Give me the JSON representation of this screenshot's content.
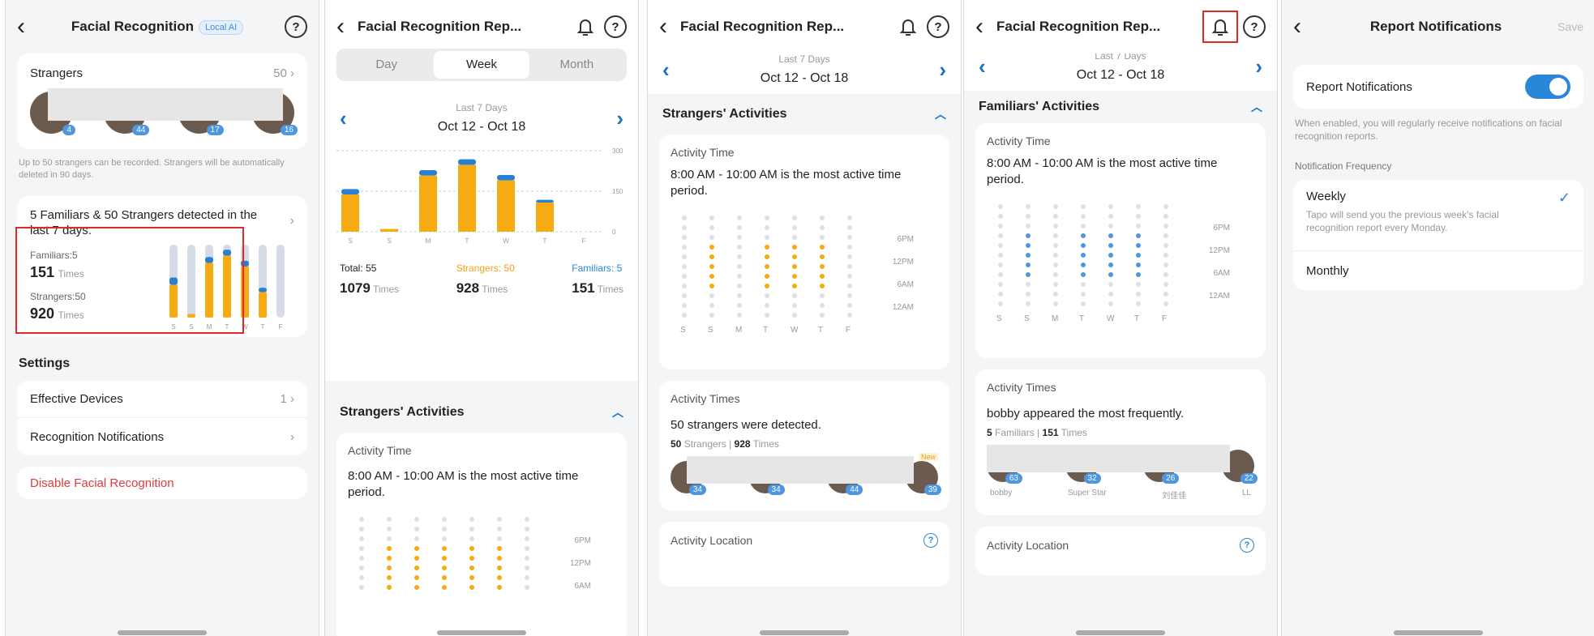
{
  "p1": {
    "title": "Facial Recognition",
    "badge": "Local AI",
    "strangers_label": "Strangers",
    "strangers_count": "50",
    "faces": [
      "4",
      "44",
      "17",
      "16"
    ],
    "note": "Up to 50 strangers can be recorded. Strangers will be automatically deleted in 90 days.",
    "summary": "5 Familiars & 50 Strangers detected in the last 7 days.",
    "familiars_label": "Familiars:5",
    "familiars_times": "151",
    "times_word": "Times",
    "strangers2_label": "Strangers:50",
    "strangers2_times": "920",
    "days": [
      "S",
      "S",
      "M",
      "T",
      "W",
      "T",
      "F"
    ],
    "bars": {
      "strangers": [
        0.45,
        0.05,
        0.75,
        0.85,
        0.7,
        0.35,
        0
      ],
      "familiars": [
        0.1,
        0,
        0.08,
        0.08,
        0.08,
        0.06,
        0
      ]
    },
    "settings_title": "Settings",
    "effective_devices": "Effective Devices",
    "effective_count": "1",
    "recognition_notifications": "Recognition Notifications",
    "disable": "Disable Facial Recognition"
  },
  "p2": {
    "title": "Facial Recognition Rep...",
    "tabs": [
      "Day",
      "Week",
      "Month"
    ],
    "range_label": "Last 7 Days",
    "range": "Oct 12 - Oct 18",
    "chart_data": {
      "type": "bar",
      "categories": [
        "S",
        "S",
        "M",
        "T",
        "W",
        "T",
        "F"
      ],
      "series": [
        {
          "name": "Strangers",
          "values": [
            138,
            10,
            208,
            248,
            190,
            108,
            0
          ]
        },
        {
          "name": "Familiars",
          "values": [
            20,
            0,
            20,
            20,
            20,
            10,
            0
          ]
        }
      ],
      "yticks": [
        "300",
        "150",
        "0"
      ],
      "ylim": [
        0,
        300
      ]
    },
    "total_label": "Total: 55",
    "total_times": "1079",
    "strangers_label": "Strangers: 50",
    "strangers_times": "928",
    "familiars_label": "Familiars: 5",
    "familiars_times": "151",
    "times_word": "Times",
    "section": "Strangers' Activities",
    "activity_time_title": "Activity Time",
    "activity_time_text": "8:00 AM - 10:00 AM is the most active time period.",
    "hours": [
      "6PM",
      "12PM",
      "6AM"
    ]
  },
  "p3": {
    "title": "Facial Recognition Rep...",
    "range_label": "Last 7 Days",
    "range": "Oct 12 - Oct 18",
    "section": "Strangers' Activities",
    "activity_time_title": "Activity Time",
    "activity_time_text": "8:00 AM - 10:00 AM is the most active time period.",
    "hours": [
      "6PM",
      "12PM",
      "6AM",
      "12AM"
    ],
    "days": [
      "S",
      "S",
      "M",
      "T",
      "W",
      "T",
      "F"
    ],
    "activity_times_title": "Activity Times",
    "activity_times_text": "50 strangers were detected.",
    "count": "50",
    "count_label": "Strangers",
    "count_times": "928",
    "times_word": "Times",
    "face_counts": [
      "34",
      "34",
      "44",
      "39"
    ],
    "new_badge": "New",
    "location_title": "Activity Location"
  },
  "p4": {
    "title": "Facial Recognition Rep...",
    "range_label": "Last 7 Days",
    "range": "Oct 12 - Oct 18",
    "section": "Familiars' Activities",
    "activity_time_title": "Activity Time",
    "activity_time_text": "8:00 AM - 10:00 AM is the most active time period.",
    "hours": [
      "6PM",
      "12PM",
      "6AM",
      "12AM"
    ],
    "days": [
      "S",
      "S",
      "M",
      "T",
      "W",
      "T",
      "F"
    ],
    "activity_times_title": "Activity Times",
    "activity_times_text": "bobby appeared the most frequently.",
    "count": "5",
    "count_label": "Familiars",
    "count_times": "151",
    "times_word": "Times",
    "face_counts": [
      "63",
      "32",
      "26",
      "22"
    ],
    "face_names": [
      "bobby",
      "Super Star",
      "刘佳佳",
      "LL"
    ],
    "location_title": "Activity Location"
  },
  "p5": {
    "title": "Report Notifications",
    "save": "Save",
    "toggle_label": "Report Notifications",
    "toggle_desc": "When enabled, you will regularly receive notifications on facial recognition reports.",
    "freq_title": "Notification Frequency",
    "weekly": "Weekly",
    "weekly_desc": "Tapo will send you the previous week's facial recognition report every Monday.",
    "monthly": "Monthly"
  },
  "colors": {
    "accent": "#2a86d8",
    "orange": "#f6ab12",
    "danger": "#e03b3b"
  }
}
